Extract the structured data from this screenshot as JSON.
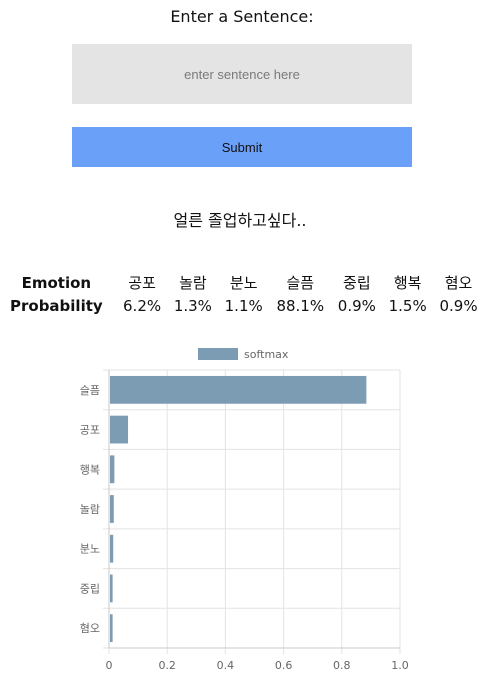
{
  "form": {
    "heading": "Enter a Sentence:",
    "input_placeholder": "enter sentence here",
    "input_value": "",
    "submit_label": "Submit"
  },
  "result": {
    "sentence": "얼른 졸업하고싶다..",
    "table": {
      "row_header_emotion": "Emotion",
      "row_header_probability": "Probability",
      "emotions": [
        "공포",
        "놀람",
        "분노",
        "슬픔",
        "중립",
        "행복",
        "혐오"
      ],
      "probabilities": [
        "6.2%",
        "1.3%",
        "1.1%",
        "88.1%",
        "0.9%",
        "1.5%",
        "0.9%"
      ]
    }
  },
  "chart_data": {
    "type": "bar",
    "orientation": "horizontal",
    "categories": [
      "슬픔",
      "공포",
      "행복",
      "놀람",
      "분노",
      "중립",
      "혐오"
    ],
    "series": [
      {
        "name": "softmax",
        "values": [
          0.881,
          0.062,
          0.015,
          0.013,
          0.011,
          0.009,
          0.009
        ]
      }
    ],
    "xlim": [
      0,
      1.0
    ],
    "xticks": [
      "0",
      "0.2",
      "0.4",
      "0.6",
      "0.8",
      "1.0"
    ],
    "legend_position": "top",
    "grid": true,
    "bar_color": "#7c9cb4"
  }
}
